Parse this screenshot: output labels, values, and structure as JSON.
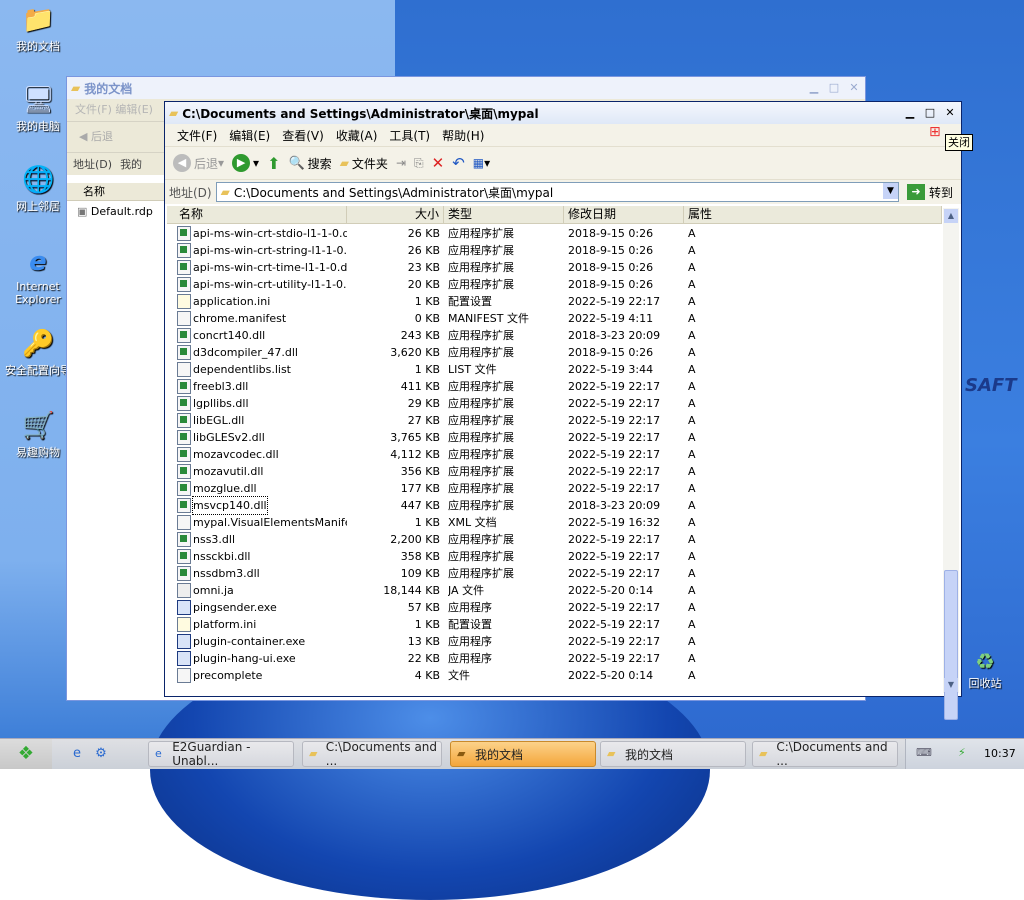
{
  "desktop": {
    "icons": [
      {
        "label": "我的文档",
        "icon": "folder-icon"
      },
      {
        "label": "我的电脑",
        "icon": "computer-icon"
      },
      {
        "label": "网上邻居",
        "icon": "network-icon"
      },
      {
        "label": "Internet Explorer",
        "icon": "ie-icon"
      },
      {
        "label": "安全配置向导",
        "icon": "security-wizard-icon"
      },
      {
        "label": "易趣购物",
        "icon": "shopping-icon"
      }
    ],
    "recycle_label": "回收站",
    "wallpaper_text": "SAFT"
  },
  "back_window": {
    "title": "我的文档",
    "menu_text": "文件(F)  编辑(E)",
    "back_label": "后退",
    "address_label": "地址(D)",
    "address_value": "我的",
    "col_name": "名称",
    "file": "Default.rdp"
  },
  "front_window": {
    "title": "C:\\Documents and Settings\\Administrator\\桌面\\mypal",
    "menu": [
      "文件(F)",
      "编辑(E)",
      "查看(V)",
      "收藏(A)",
      "工具(T)",
      "帮助(H)"
    ],
    "toolbar": {
      "back": "后退",
      "search": "搜索",
      "folders": "文件夹"
    },
    "address_label": "地址(D)",
    "address_value": "C:\\Documents and Settings\\Administrator\\桌面\\mypal",
    "go_label": "转到",
    "close_tooltip": "关闭",
    "columns": {
      "name": "名称",
      "size": "大小",
      "type": "类型",
      "modified": "修改日期",
      "attr": "属性"
    },
    "files": [
      {
        "name": "api-ms-win-crt-stdio-l1-1-0.dll",
        "size": "26 KB",
        "type": "应用程序扩展",
        "date": "2018-9-15 0:26",
        "attr": "A",
        "kind": "dll"
      },
      {
        "name": "api-ms-win-crt-string-l1-1-0.dll",
        "size": "26 KB",
        "type": "应用程序扩展",
        "date": "2018-9-15 0:26",
        "attr": "A",
        "kind": "dll"
      },
      {
        "name": "api-ms-win-crt-time-l1-1-0.dll",
        "size": "23 KB",
        "type": "应用程序扩展",
        "date": "2018-9-15 0:26",
        "attr": "A",
        "kind": "dll"
      },
      {
        "name": "api-ms-win-crt-utility-l1-1-0.dll",
        "size": "20 KB",
        "type": "应用程序扩展",
        "date": "2018-9-15 0:26",
        "attr": "A",
        "kind": "dll"
      },
      {
        "name": "application.ini",
        "size": "1 KB",
        "type": "配置设置",
        "date": "2022-5-19 22:17",
        "attr": "A",
        "kind": "ini"
      },
      {
        "name": "chrome.manifest",
        "size": "0 KB",
        "type": "MANIFEST 文件",
        "date": "2022-5-19 4:11",
        "attr": "A",
        "kind": "file"
      },
      {
        "name": "concrt140.dll",
        "size": "243 KB",
        "type": "应用程序扩展",
        "date": "2018-3-23 20:09",
        "attr": "A",
        "kind": "dll"
      },
      {
        "name": "d3dcompiler_47.dll",
        "size": "3,620 KB",
        "type": "应用程序扩展",
        "date": "2018-9-15 0:26",
        "attr": "A",
        "kind": "dll"
      },
      {
        "name": "dependentlibs.list",
        "size": "1 KB",
        "type": "LIST 文件",
        "date": "2022-5-19 3:44",
        "attr": "A",
        "kind": "file"
      },
      {
        "name": "freebl3.dll",
        "size": "411 KB",
        "type": "应用程序扩展",
        "date": "2022-5-19 22:17",
        "attr": "A",
        "kind": "dll"
      },
      {
        "name": "lgpllibs.dll",
        "size": "29 KB",
        "type": "应用程序扩展",
        "date": "2022-5-19 22:17",
        "attr": "A",
        "kind": "dll"
      },
      {
        "name": "libEGL.dll",
        "size": "27 KB",
        "type": "应用程序扩展",
        "date": "2022-5-19 22:17",
        "attr": "A",
        "kind": "dll"
      },
      {
        "name": "libGLESv2.dll",
        "size": "3,765 KB",
        "type": "应用程序扩展",
        "date": "2022-5-19 22:17",
        "attr": "A",
        "kind": "dll"
      },
      {
        "name": "mozavcodec.dll",
        "size": "4,112 KB",
        "type": "应用程序扩展",
        "date": "2022-5-19 22:17",
        "attr": "A",
        "kind": "dll"
      },
      {
        "name": "mozavutil.dll",
        "size": "356 KB",
        "type": "应用程序扩展",
        "date": "2022-5-19 22:17",
        "attr": "A",
        "kind": "dll"
      },
      {
        "name": "mozglue.dll",
        "size": "177 KB",
        "type": "应用程序扩展",
        "date": "2022-5-19 22:17",
        "attr": "A",
        "kind": "dll"
      },
      {
        "name": "msvcp140.dll",
        "size": "447 KB",
        "type": "应用程序扩展",
        "date": "2018-3-23 20:09",
        "attr": "A",
        "kind": "dll",
        "selected": true
      },
      {
        "name": "mypal.VisualElementsManifest...",
        "size": "1 KB",
        "type": "XML 文档",
        "date": "2022-5-19 16:32",
        "attr": "A",
        "kind": "file"
      },
      {
        "name": "nss3.dll",
        "size": "2,200 KB",
        "type": "应用程序扩展",
        "date": "2022-5-19 22:17",
        "attr": "A",
        "kind": "dll"
      },
      {
        "name": "nssckbi.dll",
        "size": "358 KB",
        "type": "应用程序扩展",
        "date": "2022-5-19 22:17",
        "attr": "A",
        "kind": "dll"
      },
      {
        "name": "nssdbm3.dll",
        "size": "109 KB",
        "type": "应用程序扩展",
        "date": "2022-5-19 22:17",
        "attr": "A",
        "kind": "dll"
      },
      {
        "name": "omni.ja",
        "size": "18,144 KB",
        "type": "JA 文件",
        "date": "2022-5-20 0:14",
        "attr": "A",
        "kind": "ja"
      },
      {
        "name": "pingsender.exe",
        "size": "57 KB",
        "type": "应用程序",
        "date": "2022-5-19 22:17",
        "attr": "A",
        "kind": "exe"
      },
      {
        "name": "platform.ini",
        "size": "1 KB",
        "type": "配置设置",
        "date": "2022-5-19 22:17",
        "attr": "A",
        "kind": "ini"
      },
      {
        "name": "plugin-container.exe",
        "size": "13 KB",
        "type": "应用程序",
        "date": "2022-5-19 22:17",
        "attr": "A",
        "kind": "exe"
      },
      {
        "name": "plugin-hang-ui.exe",
        "size": "22 KB",
        "type": "应用程序",
        "date": "2022-5-19 22:17",
        "attr": "A",
        "kind": "exe"
      },
      {
        "name": "precomplete",
        "size": "4 KB",
        "type": "文件",
        "date": "2022-5-20 0:14",
        "attr": "A",
        "kind": "file"
      }
    ]
  },
  "taskbar": {
    "tasks": [
      {
        "label": "E2Guardian - Unabl...",
        "icon": "ie-icon",
        "active": false
      },
      {
        "label": "C:\\Documents and ...",
        "icon": "folder-icon",
        "active": false
      },
      {
        "label": "我的文档",
        "icon": "folder-icon",
        "active": true
      },
      {
        "label": "我的文档",
        "icon": "folder-icon",
        "active": false
      },
      {
        "label": "C:\\Documents and ...",
        "icon": "folder-icon",
        "active": false
      }
    ],
    "clock": "10:37"
  },
  "colors": {
    "active_task": "#f4a63b",
    "title_selected": "#0a246a",
    "go_green": "#3a9b3a"
  }
}
